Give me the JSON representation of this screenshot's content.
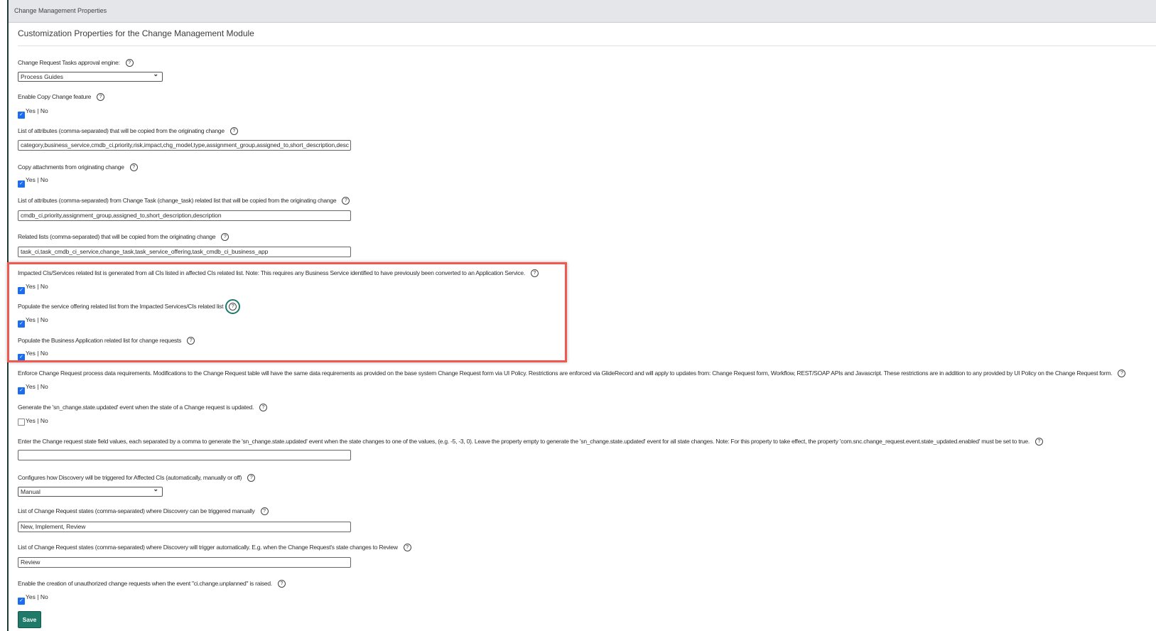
{
  "header": {
    "title": "Change Management Properties"
  },
  "page_title": "Customization Properties for the Change Management Module",
  "yes_label": "Yes",
  "no_label": "No",
  "help_icon": "?",
  "properties": [
    {
      "type": "select",
      "label": "Change Request Tasks approval engine:",
      "value": "Process Guides"
    },
    {
      "type": "checkbox",
      "label": "Enable Copy Change feature",
      "checked": true
    },
    {
      "type": "text",
      "label": "List of attributes (comma-separated) that will be copied from the originating change",
      "value": "category,business_service,cmdb_ci,priority,risk,impact,chg_model,type,assignment_group,assigned_to,short_description,desc"
    },
    {
      "type": "checkbox",
      "label": "Copy attachments from originating change",
      "checked": true
    },
    {
      "type": "text",
      "label": "List of attributes (comma-separated) from Change Task (change_task) related list that will be copied from the originating change",
      "value": "cmdb_ci,priority,assignment_group,assigned_to,short_description,description"
    },
    {
      "type": "text",
      "label": "Related lists (comma-separated) that will be copied from the originating change",
      "value": "task_ci,task_cmdb_ci_service,change_task,task_service_offering,task_cmdb_ci_business_app"
    },
    {
      "type": "checkbox",
      "label": "Impacted CIs/Services related list is generated from all CIs listed in affected CIs related list. Note: This requires any Business Service identified to have previously been converted to an Application Service.",
      "checked": true
    },
    {
      "type": "checkbox",
      "label": "Populate the service offering related list from the Impacted Services/CIs related list",
      "checked": true,
      "help_focused": true
    },
    {
      "type": "checkbox",
      "label": "Populate the Business Application related list for change requests",
      "checked": true
    },
    {
      "type": "checkbox",
      "label": "Enforce Change Request process data requirements. Modifications to the Change Request table will have the same data requirements as provided on the base system Change Request form via UI Policy. Restrictions are enforced via GlideRecord and will apply to updates from: Change Request form, Workflow, REST/SOAP APIs and Javascript. These restrictions are in addition to any provided by UI Policy on the Change Request form.",
      "checked": true
    },
    {
      "type": "checkbox",
      "label": "Generate the 'sn_change.state.updated' event when the state of a Change request is updated.",
      "checked": false
    },
    {
      "type": "text",
      "label": "Enter the Change request state field values, each separated by a comma to generate the 'sn_change.state.updated' event when the state changes to one of the values, (e.g. -5, -3, 0). Leave the property empty to generate the 'sn_change.state.updated' event for all state changes. Note: For this property to take effect, the property 'com.snc.change_request.event.state_updated.enabled' must be set to true.",
      "value": ""
    },
    {
      "type": "select",
      "label": "Configures how Discovery will be triggered for Affected CIs (automatically, manually or off)",
      "value": "Manual"
    },
    {
      "type": "text",
      "label": "List of Change Request states (comma-separated) where Discovery can be triggered manually",
      "value": "New, Implement, Review"
    },
    {
      "type": "text",
      "label": "List of Change Request states (comma-separated) where Discovery will trigger automatically. E.g. when the Change Request's state changes to Review",
      "value": "Review"
    },
    {
      "type": "checkbox",
      "label": "Enable the creation of unauthorized change requests when the event \"ci.change.unplanned\" is raised.",
      "checked": true
    }
  ],
  "save_label": "Save",
  "colors": {
    "accent": "#1f7a6a",
    "highlight": "#ee5a4f",
    "checkbox": "#1a6df0"
  }
}
